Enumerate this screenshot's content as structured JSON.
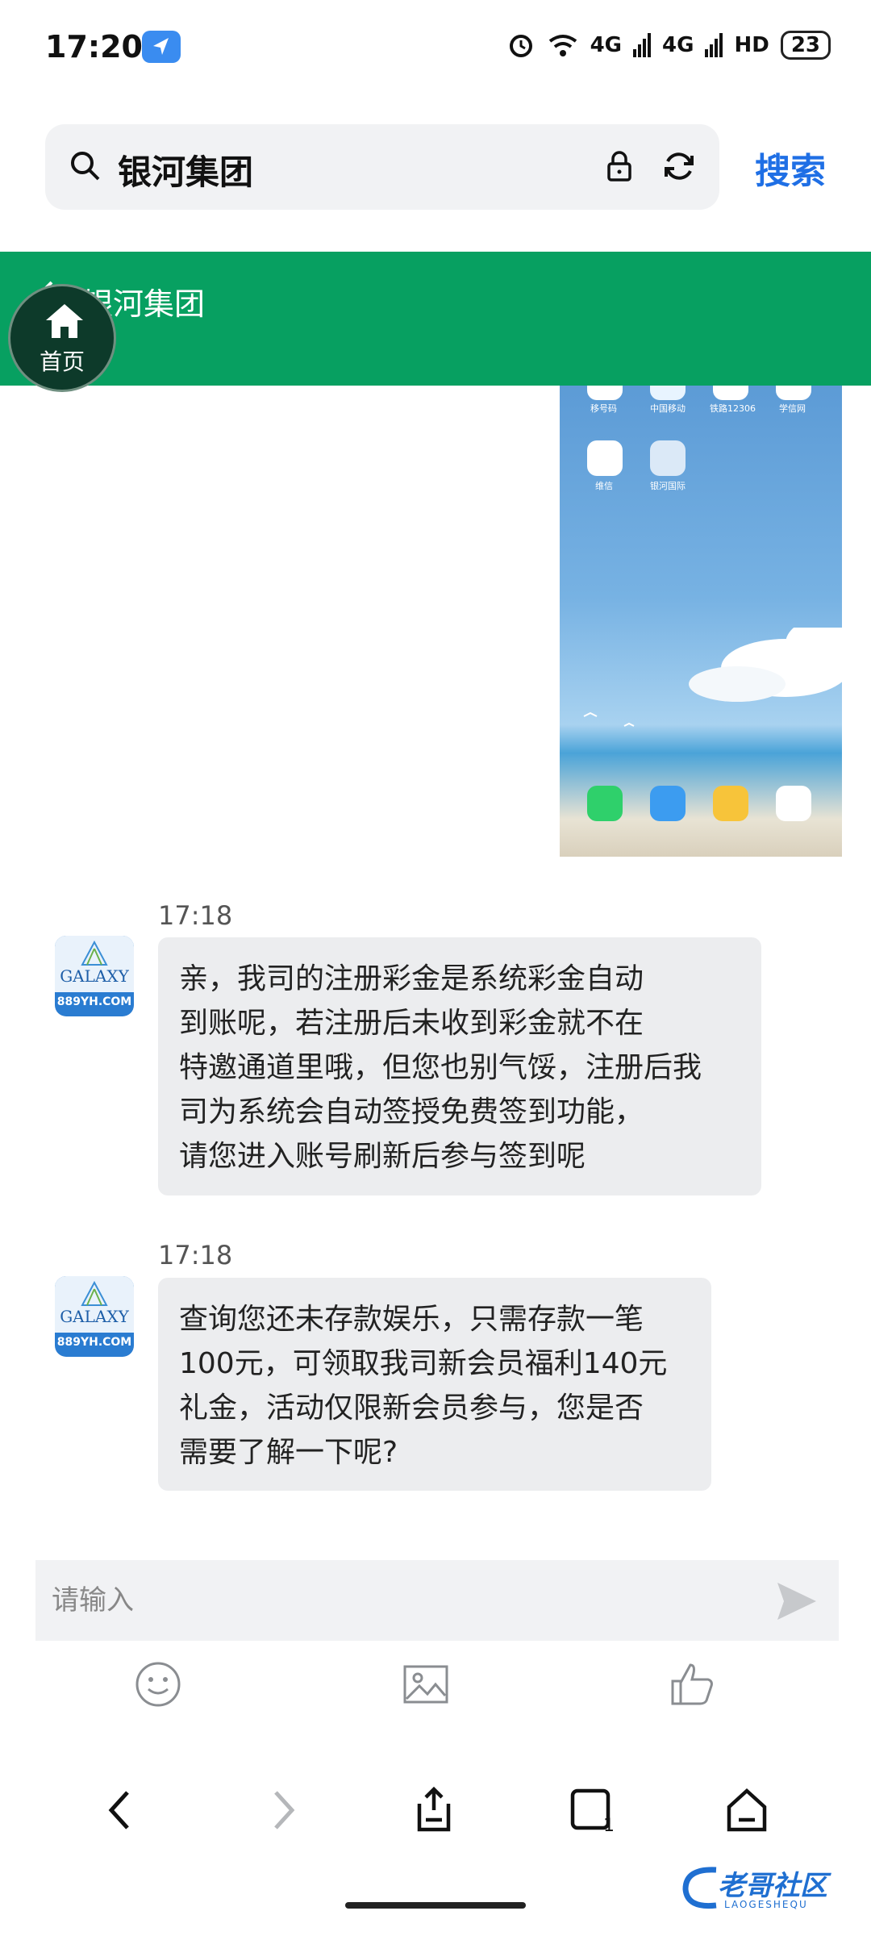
{
  "status_bar": {
    "time": "17:20",
    "signal1": "4G",
    "signal2": "4G",
    "hd": "HD",
    "battery": "23"
  },
  "browser": {
    "search_query": "银河集团",
    "search_button": "搜索"
  },
  "chat": {
    "header_title": "银河集团",
    "home_label": "首页",
    "screenshot_labels": [
      "移号码",
      "中国移动",
      "铁路12306",
      "学信网",
      "维信",
      "银河国际"
    ],
    "avatar_name": "GALAXY",
    "avatar_domain": "889YH.COM",
    "messages": [
      {
        "time": "17:18",
        "text": "亲，我司的注册彩金是系统彩金自动\n到账呢，若注册后未收到彩金就不在\n特邀通道里哦，但您也别气馁，注册后我\n司为系统会自动签授免费签到功能，\n请您进入账号刷新后参与签到呢"
      },
      {
        "time": "17:18",
        "text": "查询您还未存款娱乐，只需存款一笔\n100元，可领取我司新会员福利140元\n礼金，活动仅限新会员参与，您是否\n需要了解一下呢?"
      }
    ],
    "input_placeholder": "请输入"
  },
  "watermark": {
    "title": "老哥社区",
    "subtitle": "LAOGESHEQU"
  },
  "colors": {
    "header_green": "#07a061",
    "search_blue": "#1f6fe5",
    "bubble_gray": "#ecedef"
  }
}
